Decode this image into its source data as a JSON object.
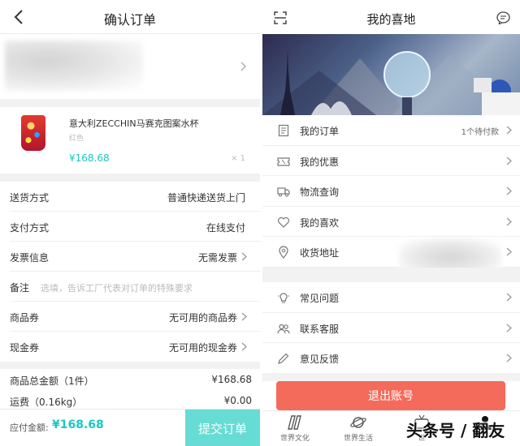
{
  "left": {
    "header": {
      "title": "确认订单"
    },
    "product": {
      "name": "意大利ZECCHIN马赛克图案水杯",
      "color": "红色",
      "price": "¥168.68",
      "qty": "× 1"
    },
    "rows": [
      {
        "label": "送货方式",
        "value": "普通快递送货上门",
        "arrow": false
      },
      {
        "label": "支付方式",
        "value": "在线支付",
        "arrow": false
      },
      {
        "label": "发票信息",
        "value": "无需发票",
        "arrow": true
      },
      {
        "label": "备注",
        "placeholder": "选填，告诉工厂代表对订单的特殊要求"
      },
      {
        "label": "商品券",
        "value": "无可用的商品券",
        "arrow": true
      },
      {
        "label": "现金券",
        "value": "无可用的现金券",
        "arrow": true
      }
    ],
    "summary": [
      {
        "label": "商品总金额（1件）",
        "value": "¥168.68"
      },
      {
        "label": "运费（0.16kg）",
        "value": "¥0.00"
      }
    ],
    "paybar": {
      "label": "应付金额:",
      "amount": "¥168.68",
      "submit": "提交订单"
    }
  },
  "right": {
    "header": {
      "title": "我的喜地"
    },
    "menu_group1": [
      {
        "label": "我的订单",
        "value": "1个待付款",
        "icon": "document-icon"
      },
      {
        "label": "我的优惠",
        "value": "",
        "icon": "coupon-icon"
      },
      {
        "label": "物流查询",
        "value": "",
        "icon": "truck-icon"
      },
      {
        "label": "我的喜欢",
        "value": "",
        "icon": "heart-icon"
      },
      {
        "label": "收货地址",
        "value": "",
        "icon": "location-pin-icon"
      }
    ],
    "menu_group2": [
      {
        "label": "常见问题",
        "icon": "lightbulb-icon"
      },
      {
        "label": "联系客服",
        "icon": "people-icon"
      },
      {
        "label": "意见反馈",
        "icon": "pencil-icon"
      }
    ],
    "logout": "退出账号",
    "tabs": [
      {
        "label": "世界文化",
        "icon": "book-icon"
      },
      {
        "label": "世界生活",
        "icon": "planet-icon"
      },
      {
        "label": "世",
        "icon": "tv-icon"
      },
      {
        "label": "",
        "icon": "person-icon"
      }
    ]
  },
  "watermark": "头条号 / 翻友",
  "colors": {
    "accent": "#1cc7c1",
    "submit": "#66dcd4",
    "logout": "#f46b5b"
  }
}
